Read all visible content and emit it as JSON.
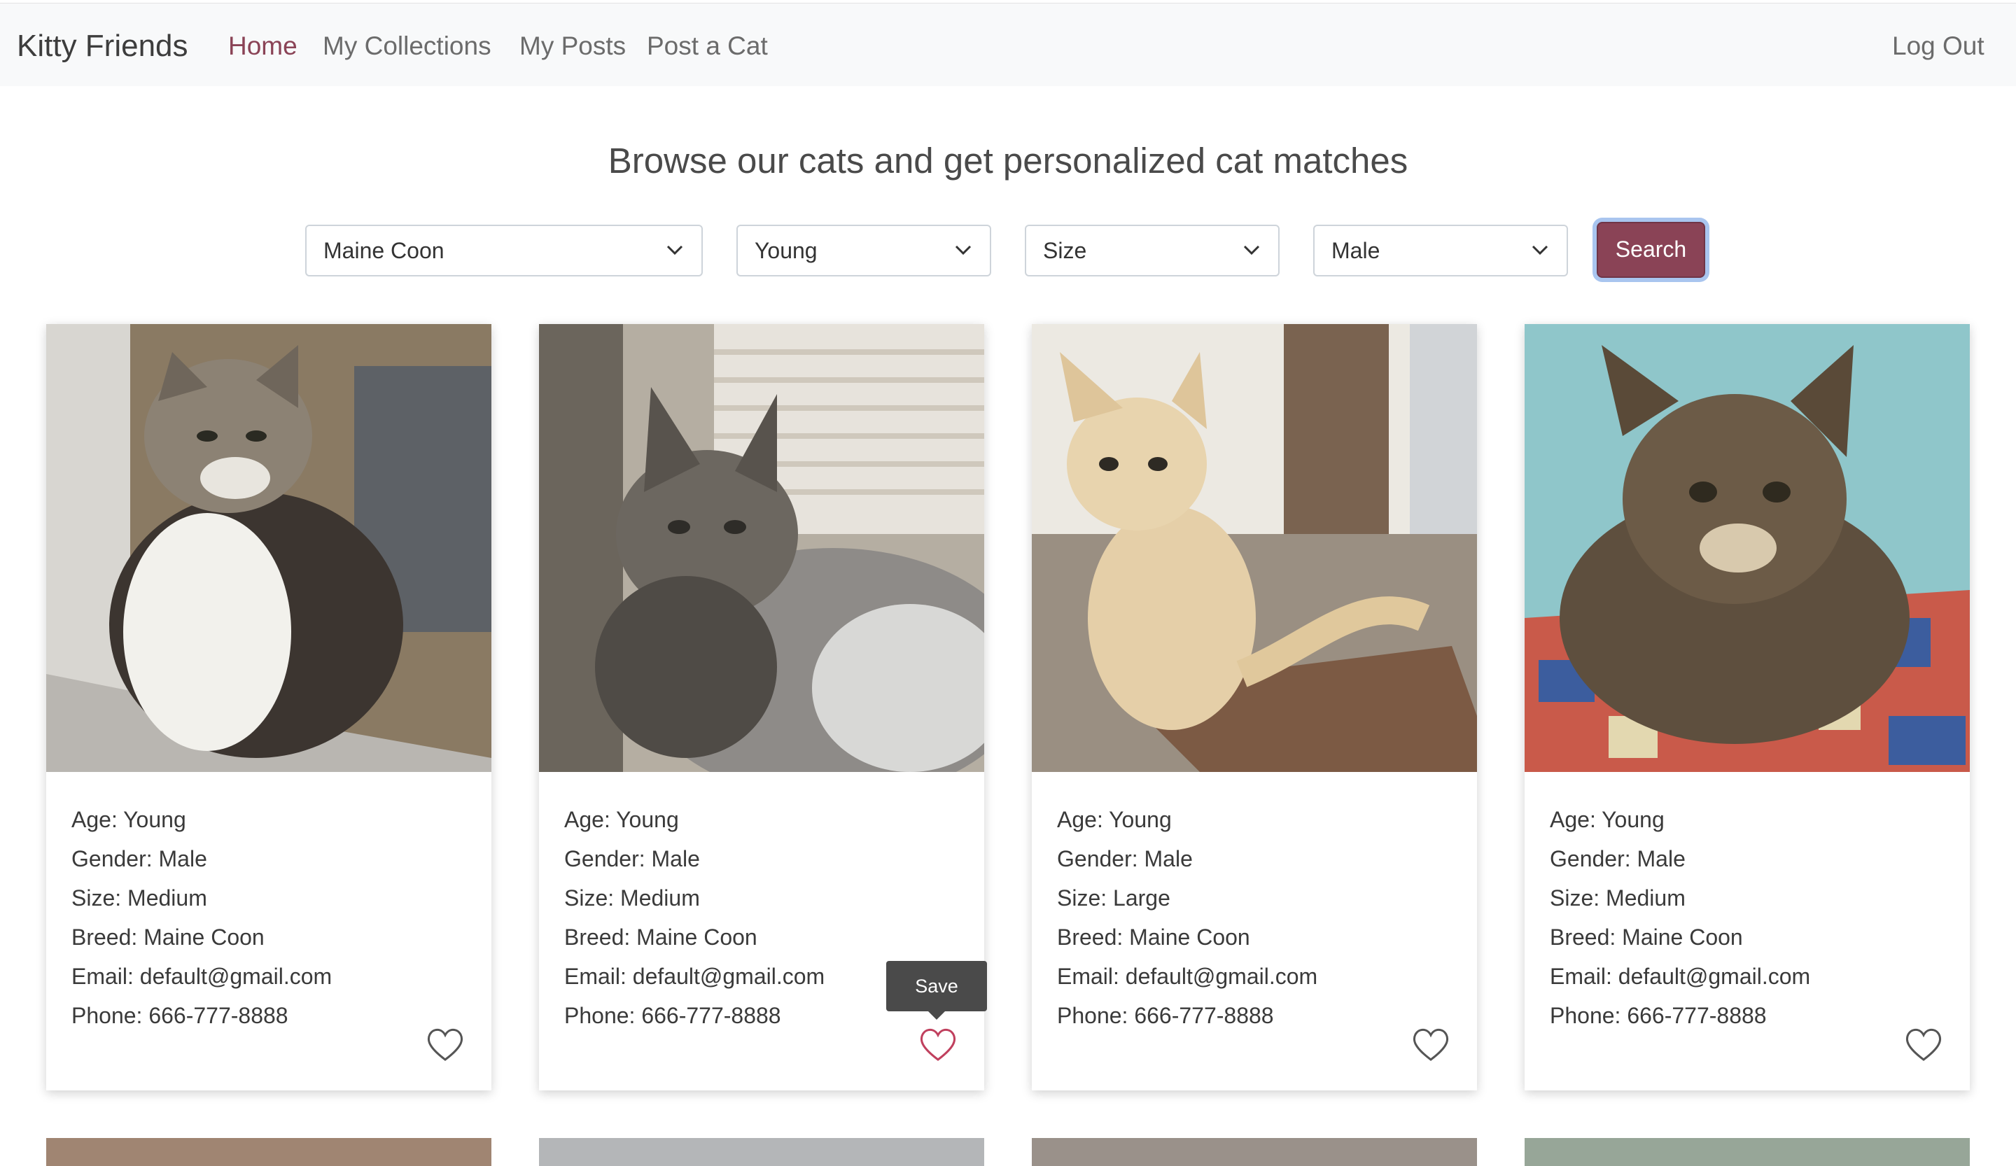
{
  "nav": {
    "brand": "Kitty Friends",
    "links": [
      "Home",
      "My Collections",
      "My Posts",
      "Post a Cat"
    ],
    "logout": "Log Out",
    "active_color": "#8a4356"
  },
  "title": "Browse our cats and get personalized cat matches",
  "filters": {
    "breed": "Maine Coon",
    "age": "Young",
    "size": "Size",
    "gender": "Male",
    "search_label": "Search"
  },
  "tooltip": "Save",
  "cards": [
    {
      "age": "Age: Young",
      "gender": "Gender: Male",
      "size": "Size: Medium",
      "breed": "Breed: Maine Coon",
      "email": "Email: default@gmail.com",
      "phone": "Phone: 666-777-8888",
      "photo": "white-and-tabby cat sitting by window"
    },
    {
      "age": "Age: Young",
      "gender": "Gender: Male",
      "size": "Size: Medium",
      "breed": "Breed: Maine Coon",
      "email": "Email: default@gmail.com",
      "phone": "Phone: 666-777-8888",
      "photo": "long-haired grey tabby cat lying down"
    },
    {
      "age": "Age: Young",
      "gender": "Gender: Male",
      "size": "Size: Large",
      "breed": "Breed: Maine Coon",
      "email": "Email: default@gmail.com",
      "phone": "Phone: 666-777-8888",
      "photo": "cream cat sitting on cat tree"
    },
    {
      "age": "Age: Young",
      "gender": "Gender: Male",
      "size": "Size: Medium",
      "breed": "Breed: Maine Coon",
      "email": "Email: default@gmail.com",
      "phone": "Phone: 666-777-8888",
      "photo": "brown tabby cat on quilt"
    }
  ],
  "icons": {
    "heart": "heart-icon",
    "chevron": "chevron-down-icon"
  }
}
